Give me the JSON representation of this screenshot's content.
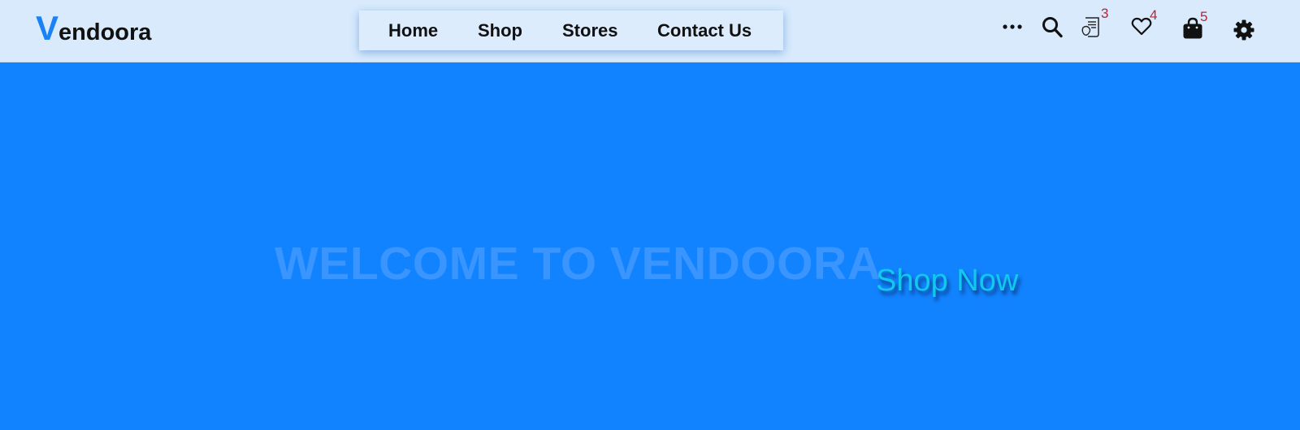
{
  "brand": {
    "initial": "V",
    "rest": "endoora"
  },
  "nav": {
    "items": [
      {
        "label": "Home"
      },
      {
        "label": "Shop"
      },
      {
        "label": "Stores"
      },
      {
        "label": "Contact Us"
      }
    ]
  },
  "header_icons": {
    "more": {
      "icon": "more-horizontal-icon"
    },
    "search": {
      "icon": "search-icon"
    },
    "orders": {
      "icon": "receipt-icon",
      "count": "3"
    },
    "wishlist": {
      "icon": "heart-icon",
      "count": "4"
    },
    "cart": {
      "icon": "shopping-bag-icon",
      "count": "5"
    },
    "settings": {
      "icon": "gear-icon"
    }
  },
  "hero": {
    "title": "WELCOME TO VENDOORA",
    "cta_label": "Shop Now"
  },
  "colors": {
    "header_bg": "#d8eafc",
    "hero_bg": "#1283ff",
    "brand_accent": "#1a82f4",
    "hero_title": "#3a95ff",
    "cta": "#12c8ee",
    "badge": "#b0283a"
  }
}
